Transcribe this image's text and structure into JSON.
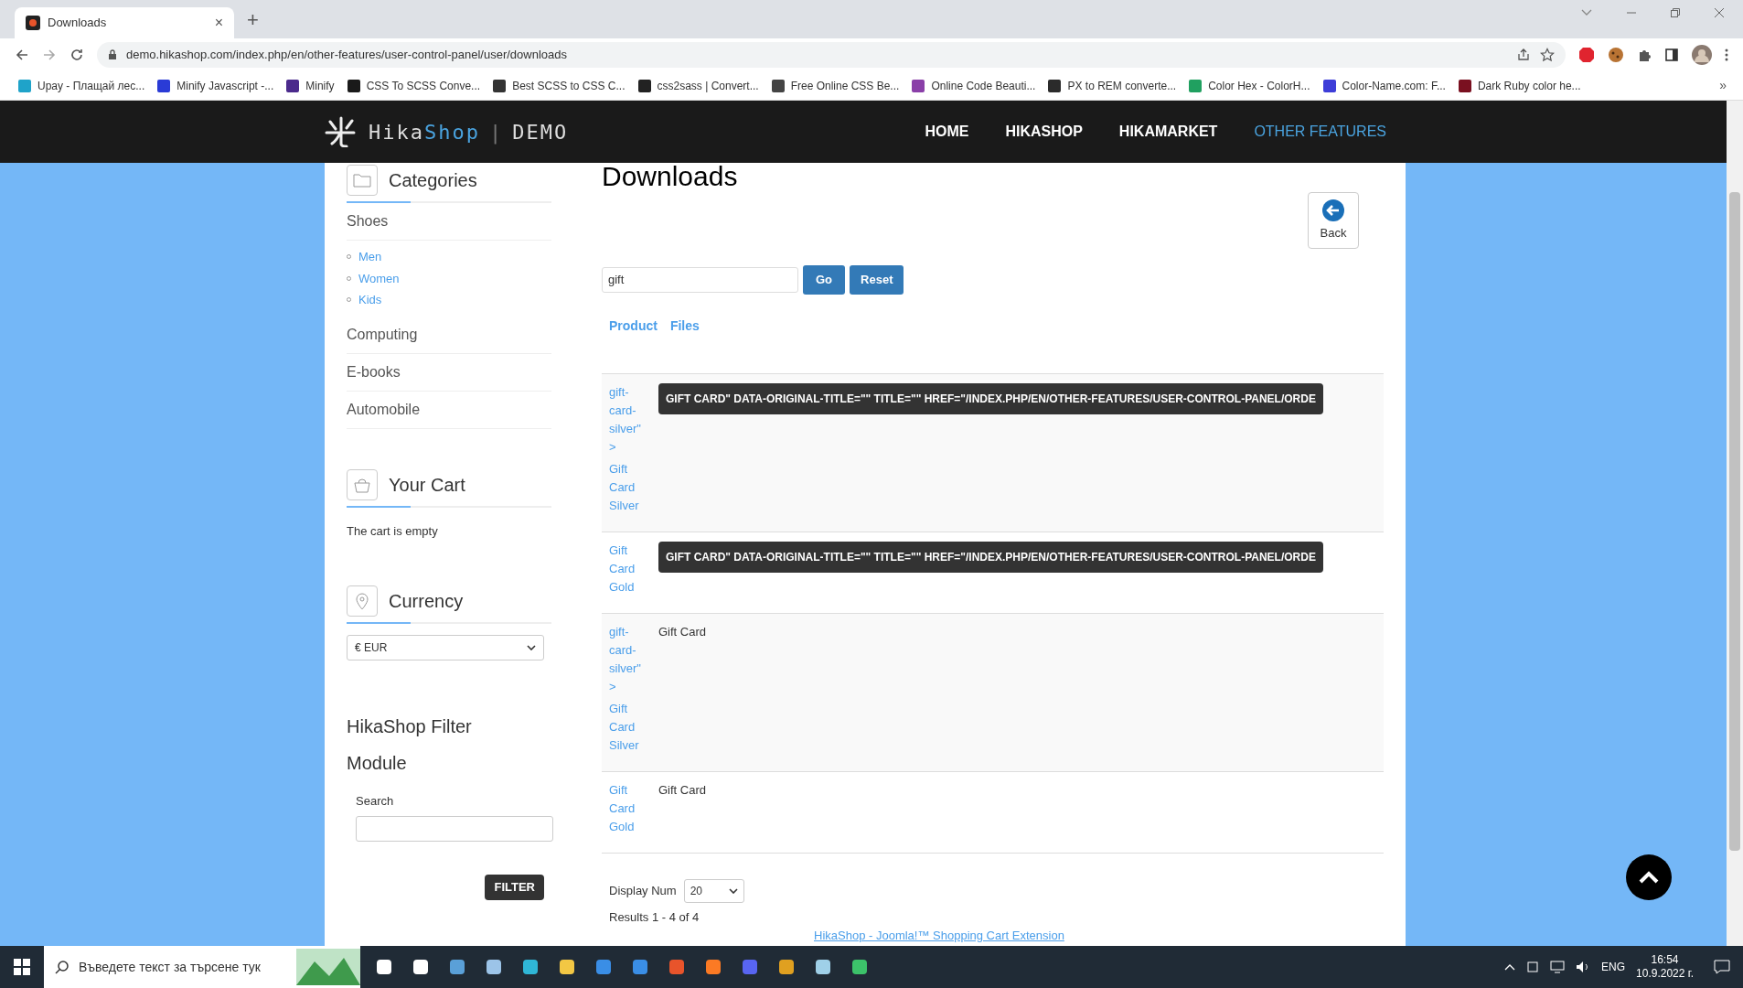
{
  "browser": {
    "tab": {
      "title": "Downloads",
      "close": "×"
    },
    "new_tab": "+",
    "url": "demo.hikashop.com/index.php/en/other-features/user-control-panel/user/downloads",
    "bookmarks": [
      {
        "label": "Upay - Плащай лес...",
        "color": "#1fa3c9"
      },
      {
        "label": "Minify Javascript -...",
        "color": "#2a3bd6"
      },
      {
        "label": "Minify",
        "color": "#4b2a8c"
      },
      {
        "label": "CSS To SCSS Conve...",
        "color": "#1a1a1a"
      },
      {
        "label": "Best SCSS to CSS C...",
        "color": "#333333"
      },
      {
        "label": "css2sass | Convert...",
        "color": "#222222"
      },
      {
        "label": "Free Online CSS Be...",
        "color": "#444444"
      },
      {
        "label": "Online Code Beauti...",
        "color": "#8a3fa8"
      },
      {
        "label": "PX to REM converte...",
        "color": "#2b2b2b"
      },
      {
        "label": "Color Hex - ColorH...",
        "color": "#20a060"
      },
      {
        "label": "Color-Name.com: F...",
        "color": "#3d3dd8"
      },
      {
        "label": "Dark Ruby color he...",
        "color": "#7a1020"
      }
    ],
    "more": "»"
  },
  "header": {
    "brand_a": "Hika",
    "brand_b": "Shop",
    "separator": "|",
    "demo": "DEMO",
    "nav": [
      {
        "label": "HOME",
        "selected": false
      },
      {
        "label": "HIKASHOP",
        "selected": false
      },
      {
        "label": "HIKAMARKET",
        "selected": false
      },
      {
        "label": "OTHER FEATURES",
        "selected": true
      }
    ]
  },
  "sidebar": {
    "categories": {
      "title": "Categories",
      "items": [
        {
          "label": "Shoes",
          "children": [
            {
              "label": "Men"
            },
            {
              "label": "Women"
            },
            {
              "label": "Kids"
            }
          ]
        },
        {
          "label": "Computing"
        },
        {
          "label": "E-books"
        },
        {
          "label": "Automobile"
        }
      ]
    },
    "cart": {
      "title": "Your Cart",
      "text": "The cart is empty"
    },
    "currency": {
      "title": "Currency",
      "value": "€ EUR"
    },
    "filter": {
      "title": "HikaShop Filter Module",
      "search_label": "Search",
      "button": "FILTER"
    }
  },
  "content": {
    "title": "Downloads",
    "back": "Back",
    "search": {
      "value": "gift"
    },
    "go": "Go",
    "reset": "Reset",
    "columns": [
      "Product",
      "Files"
    ],
    "rows": [
      {
        "product": [
          "gift-card-silver\">",
          "Gift Card Silver"
        ],
        "kind": "tooltip",
        "file": "GIFT CARD\" DATA-ORIGINAL-TITLE=\"\" TITLE=\"\" HREF=\"/INDEX.PHP/EN/OTHER-FEATURES/USER-CONTROL-PANEL/ORDE"
      },
      {
        "product": [
          "Gift Card Gold"
        ],
        "kind": "tooltip",
        "file": "GIFT CARD\" DATA-ORIGINAL-TITLE=\"\" TITLE=\"\" HREF=\"/INDEX.PHP/EN/OTHER-FEATURES/USER-CONTROL-PANEL/ORDE"
      },
      {
        "product": [
          "gift-card-silver\">",
          "Gift Card Silver"
        ],
        "kind": "text",
        "file": "Gift Card"
      },
      {
        "product": [
          "Gift Card Gold"
        ],
        "kind": "text",
        "file": "Gift Card"
      }
    ],
    "display_num_label": "Display Num",
    "display_num": "20",
    "results": "Results 1 - 4 of 4",
    "footer_link": "HikaShop - Joomla!™ Shopping Cart Extension"
  },
  "taskbar": {
    "search_placeholder": "Въведете текст за търсене тук",
    "language": "ENG",
    "time": "16:54",
    "date": "10.9.2022 г."
  }
}
